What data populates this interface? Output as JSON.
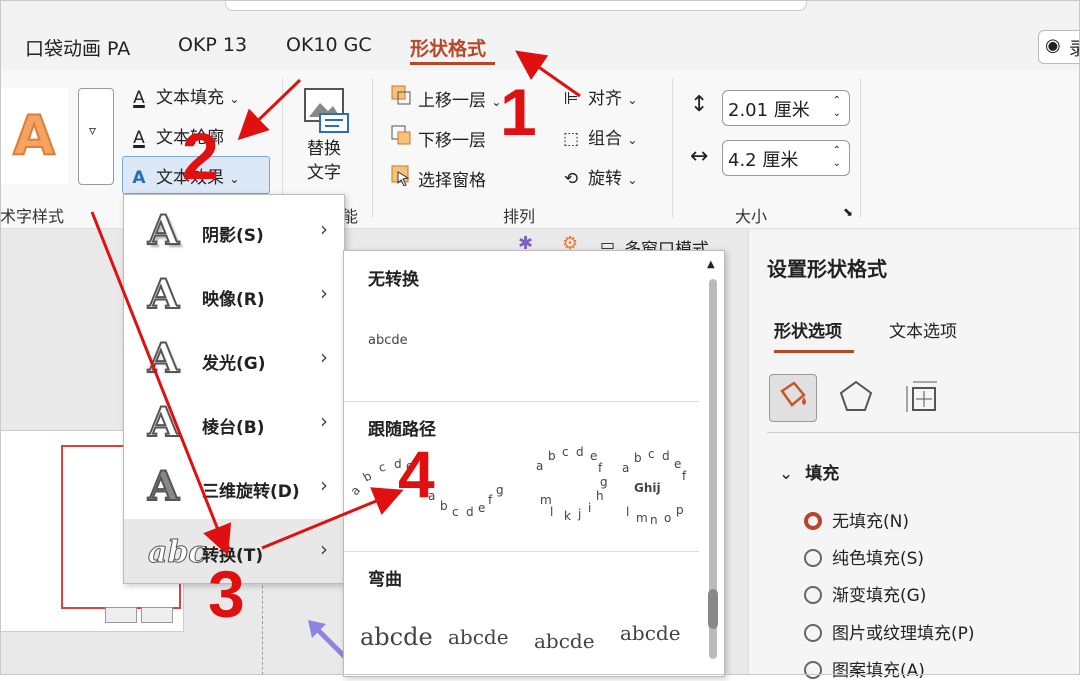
{
  "tabs": [
    {
      "label": "口袋动画 PA"
    },
    {
      "label": "OKP 13"
    },
    {
      "label": "OK10 GC"
    },
    {
      "label": "形状格式"
    }
  ],
  "record_button": {
    "label": "录"
  },
  "ribbon": {
    "wordart_styles_label": "术字样式",
    "text_fill": "文本填充",
    "text_outline": "文本轮廓",
    "text_effect": "文本效果",
    "alt_text_line1": "替换",
    "alt_text_line2": "文字",
    "accessibility_label": "能",
    "bring_forward": "上移一层",
    "send_backward": "下移一层",
    "selection_pane": "选择窗格",
    "align": "对齐",
    "group": "组合",
    "rotate": "旋转",
    "arrange_label": "排列",
    "height_value": "2.01 厘米",
    "width_value": "4.2 厘米",
    "size_label": "大小",
    "multiwindow": "多窗口模式"
  },
  "effect_menu": {
    "items": [
      {
        "label": "阴影(S)"
      },
      {
        "label": "映像(R)"
      },
      {
        "label": "发光(G)"
      },
      {
        "label": "棱台(B)"
      },
      {
        "label": "三维旋转(D)"
      },
      {
        "label": "转换(T)"
      }
    ]
  },
  "transform_menu": {
    "no_transform": "无转换",
    "sample_text": "abcde",
    "follow_path": "跟随路径",
    "warp": "弯曲",
    "circle_text": "Ghij"
  },
  "panel": {
    "title": "设置形状格式",
    "tab_shape": "形状选项",
    "tab_text": "文本选项",
    "fill_heading": "填充",
    "options": [
      {
        "label": "无填充(N)",
        "selected": true
      },
      {
        "label": "纯色填充(S)",
        "selected": false
      },
      {
        "label": "渐变填充(G)",
        "selected": false
      },
      {
        "label": "图片或纹理填充(P)",
        "selected": false
      },
      {
        "label": "图案填充(A)",
        "selected": false
      }
    ]
  },
  "annotations": [
    "1",
    "2",
    "3",
    "4"
  ],
  "colors": {
    "accent": "#b7472a",
    "annotation": "#e01010"
  }
}
